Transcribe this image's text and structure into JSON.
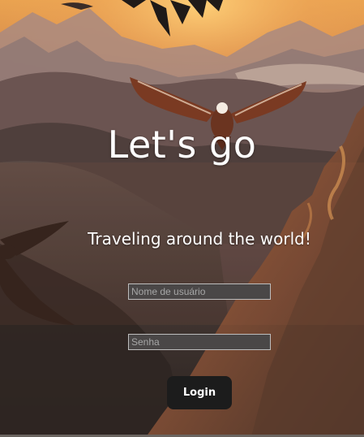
{
  "hero": {
    "title": "Let's go",
    "subtitle": "Traveling around the world!"
  },
  "login_form": {
    "username_placeholder": "Nome de usuário",
    "password_placeholder": "Senha",
    "login_label": "Login"
  },
  "colors": {
    "field_background": "#4a4747",
    "field_border": "#bdbdbd",
    "button_background": "#1c1c1c",
    "text": "#ffffff"
  }
}
